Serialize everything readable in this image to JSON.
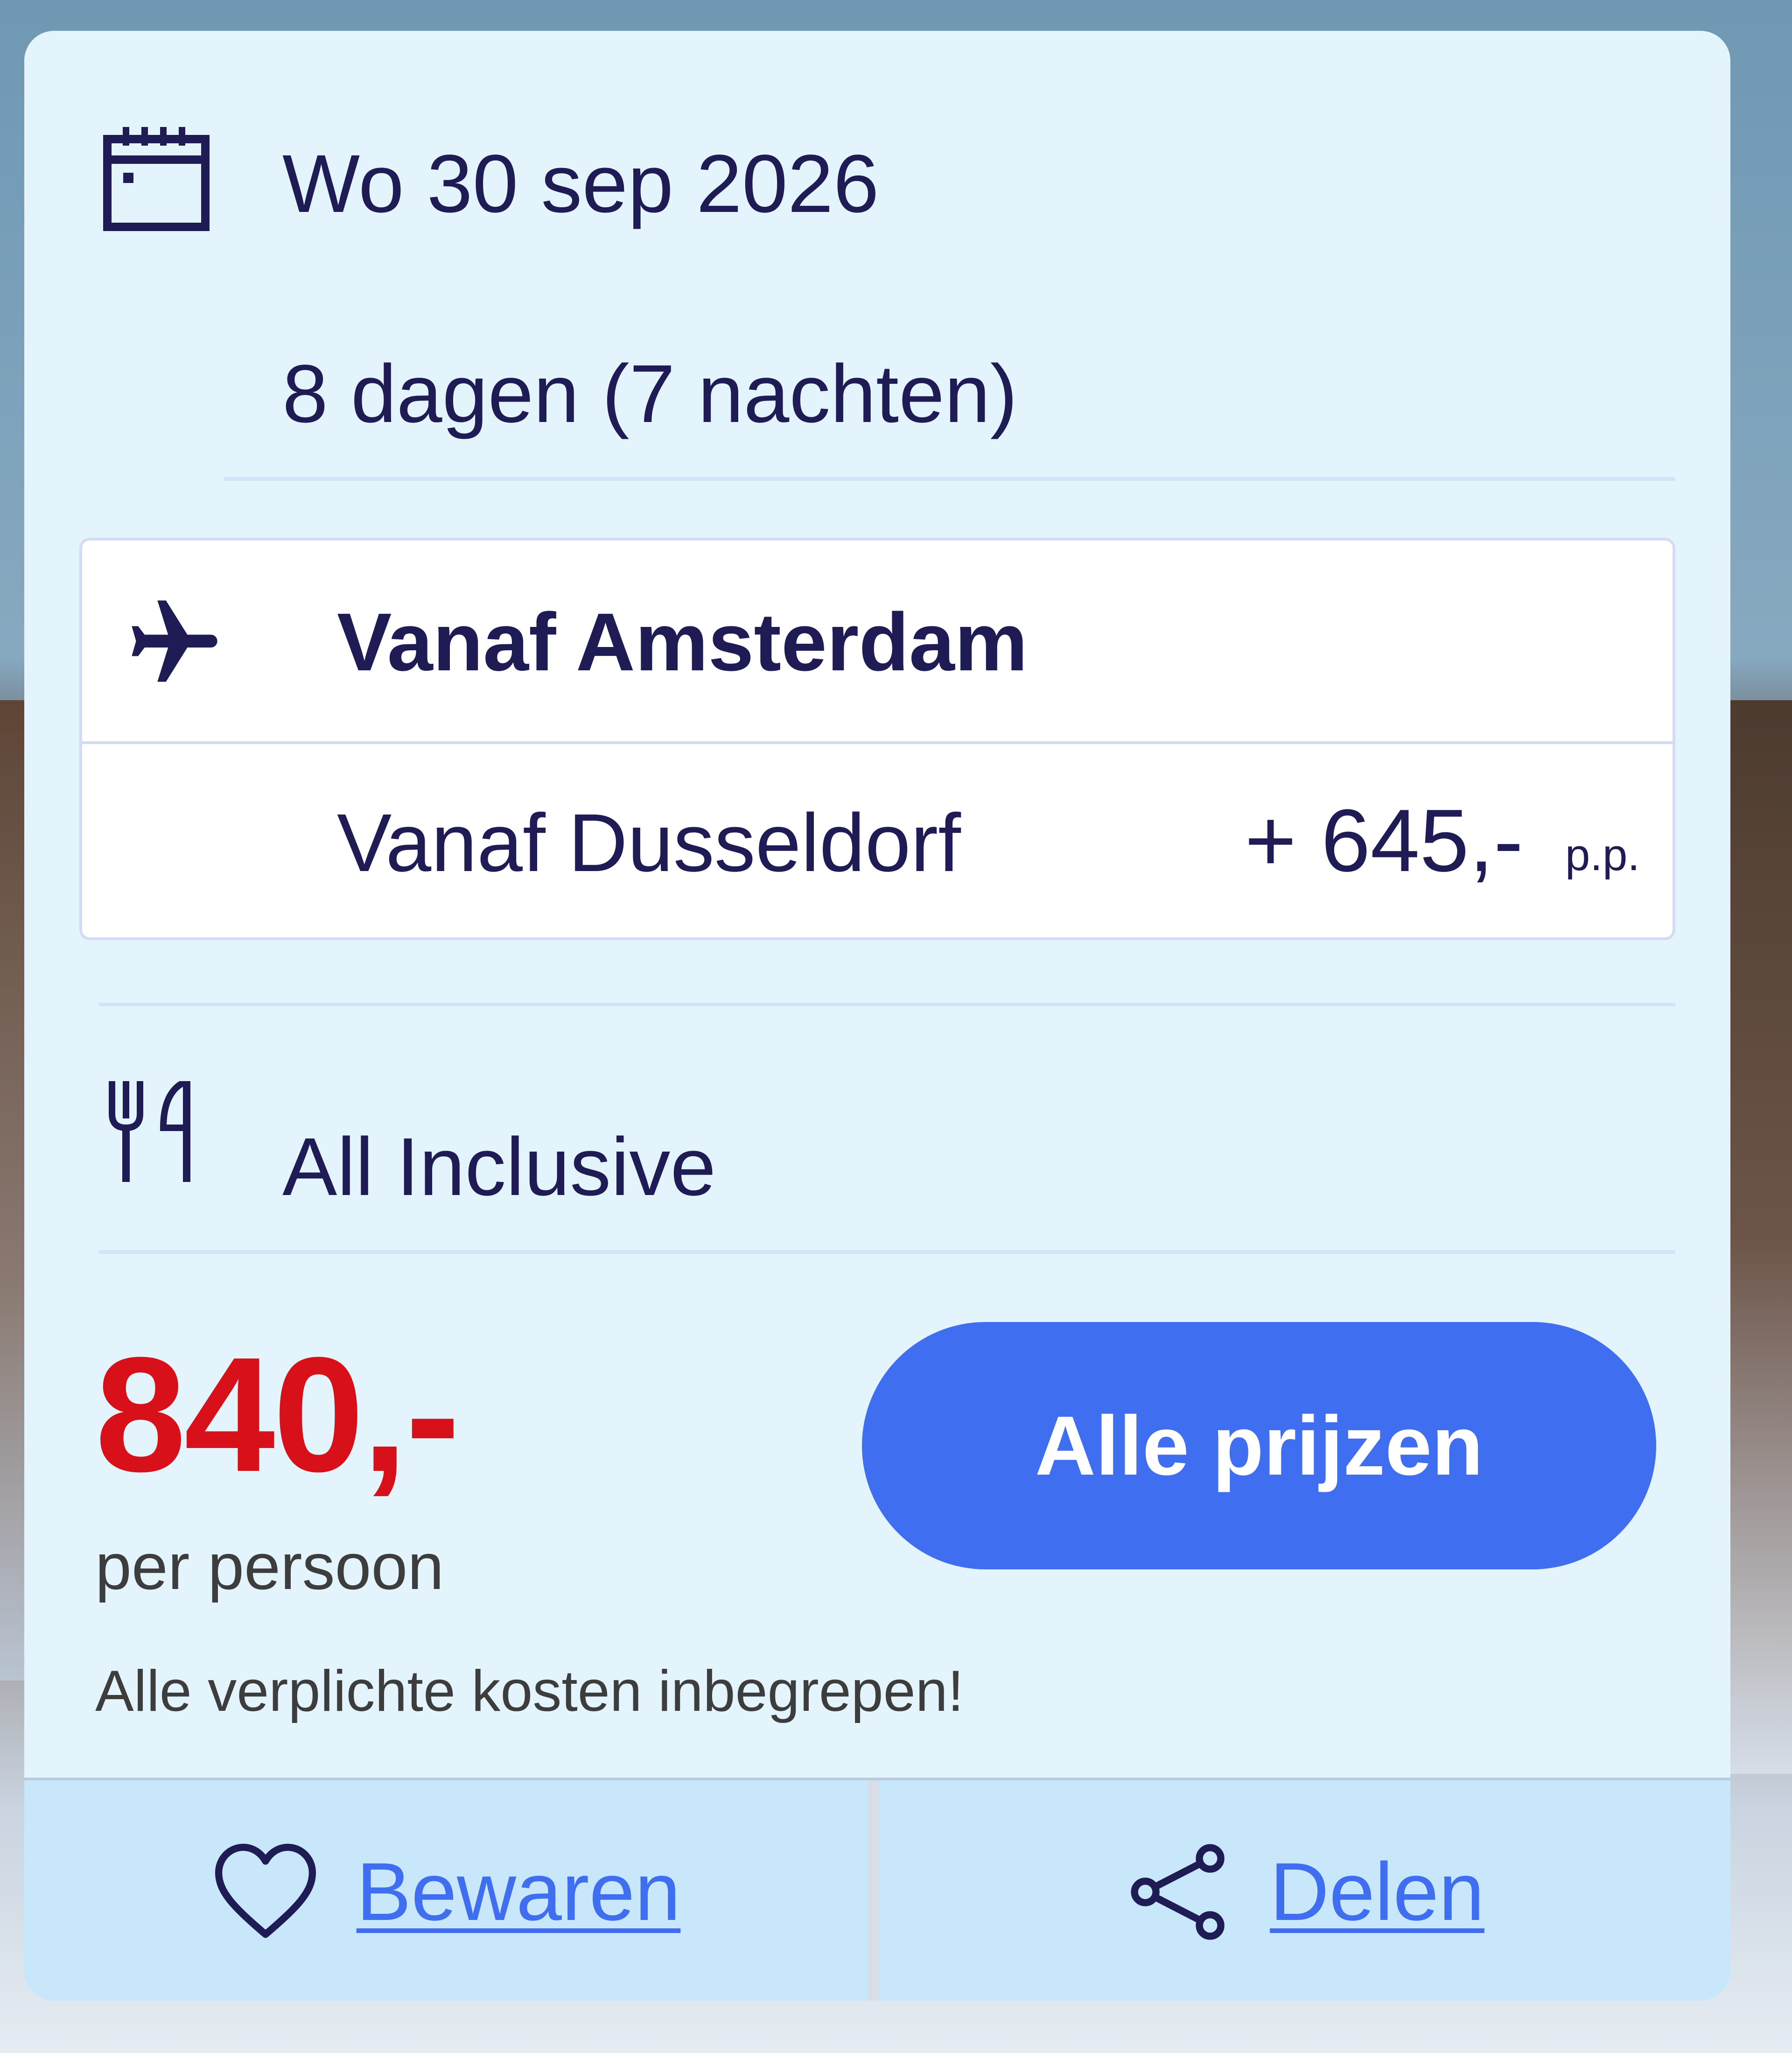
{
  "departure": {
    "date": "Wo 30 sep 2026",
    "duration": "8 dagen (7 nachten)",
    "icon": "calendar-icon"
  },
  "flights": {
    "icon": "plane-icon",
    "options": [
      {
        "label": "Vanaf Amsterdam",
        "selected": true
      },
      {
        "label": "Vanaf Dusseldorf",
        "surcharge": "+ 645,-",
        "unit": "p.p."
      }
    ]
  },
  "board": {
    "label": "All Inclusive",
    "icon": "cutlery-icon"
  },
  "pricing": {
    "price": "840,-",
    "per_person": "per persoon",
    "note": "Alle verplichte kosten inbegrepen!",
    "button_label": "Alle prijzen",
    "price_color": "#d81019",
    "button_color": "#3f6ff0"
  },
  "actions": {
    "save_label": "Bewaren",
    "save_icon": "heart-icon",
    "share_label": "Delen",
    "share_icon": "share-icon"
  }
}
